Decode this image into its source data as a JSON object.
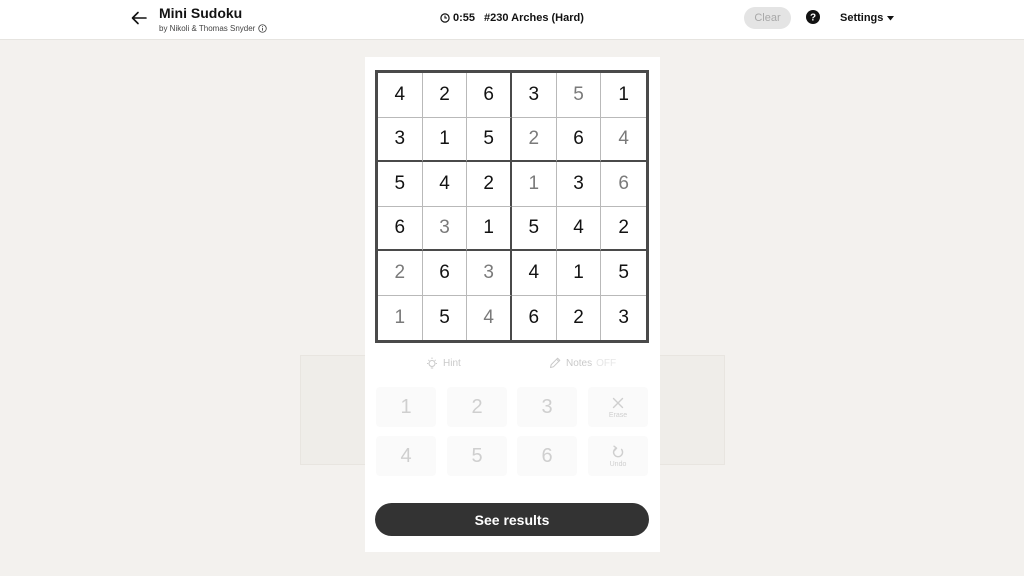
{
  "header": {
    "title": "Mini Sudoku",
    "byline": "by Nikoli & Thomas Snyder",
    "timer": "0:55",
    "puzzle": "#230 Arches (Hard)",
    "clear_label": "Clear",
    "settings_label": "Settings"
  },
  "board": {
    "size": 6,
    "cells": [
      [
        {
          "v": "4",
          "t": "given"
        },
        {
          "v": "2",
          "t": "given"
        },
        {
          "v": "6",
          "t": "given"
        },
        {
          "v": "3",
          "t": "given"
        },
        {
          "v": "5",
          "t": "entered"
        },
        {
          "v": "1",
          "t": "given"
        }
      ],
      [
        {
          "v": "3",
          "t": "given"
        },
        {
          "v": "1",
          "t": "given"
        },
        {
          "v": "5",
          "t": "given"
        },
        {
          "v": "2",
          "t": "entered"
        },
        {
          "v": "6",
          "t": "given"
        },
        {
          "v": "4",
          "t": "entered"
        }
      ],
      [
        {
          "v": "5",
          "t": "given"
        },
        {
          "v": "4",
          "t": "given"
        },
        {
          "v": "2",
          "t": "given"
        },
        {
          "v": "1",
          "t": "entered"
        },
        {
          "v": "3",
          "t": "given"
        },
        {
          "v": "6",
          "t": "entered"
        }
      ],
      [
        {
          "v": "6",
          "t": "given"
        },
        {
          "v": "3",
          "t": "entered"
        },
        {
          "v": "1",
          "t": "given"
        },
        {
          "v": "5",
          "t": "given"
        },
        {
          "v": "4",
          "t": "given"
        },
        {
          "v": "2",
          "t": "given"
        }
      ],
      [
        {
          "v": "2",
          "t": "entered"
        },
        {
          "v": "6",
          "t": "given"
        },
        {
          "v": "3",
          "t": "entered"
        },
        {
          "v": "4",
          "t": "given"
        },
        {
          "v": "1",
          "t": "given"
        },
        {
          "v": "5",
          "t": "given"
        }
      ],
      [
        {
          "v": "1",
          "t": "entered"
        },
        {
          "v": "5",
          "t": "given"
        },
        {
          "v": "4",
          "t": "entered"
        },
        {
          "v": "6",
          "t": "given"
        },
        {
          "v": "2",
          "t": "given"
        },
        {
          "v": "3",
          "t": "given"
        }
      ]
    ]
  },
  "tools": {
    "hint_label": "Hint",
    "notes_label": "Notes",
    "notes_state": "OFF"
  },
  "keypad": {
    "row1": [
      "1",
      "2",
      "3"
    ],
    "row2": [
      "4",
      "5",
      "6"
    ],
    "erase_label": "Erase",
    "undo_label": "Undo"
  },
  "results_label": "See results",
  "colors": {
    "given": "#121212",
    "entered": "#7a7a7a",
    "button_dark": "#333333"
  }
}
